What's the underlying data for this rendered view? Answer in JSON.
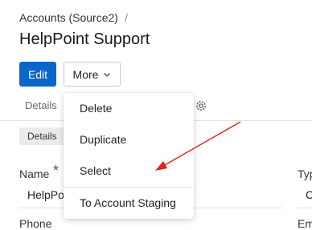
{
  "breadcrumb": {
    "parent": "Accounts (Source2)",
    "separator": "/"
  },
  "title": "HelpPoint Support",
  "toolbar": {
    "edit_label": "Edit",
    "more_label": "More"
  },
  "tabs": {
    "details": "Details",
    "settings_icon": "gear-icon"
  },
  "section": {
    "label": "Details"
  },
  "fields": {
    "name_label": "Name",
    "name_required": "*",
    "name_value": "HelpPoint Support",
    "type_label": "Typ",
    "type_value": "C",
    "phone_label": "Phone",
    "email_label": "Em"
  },
  "more_menu": {
    "items": [
      "Delete",
      "Duplicate",
      "Select",
      "To Account Staging"
    ]
  },
  "colors": {
    "primary": "#0a66c9",
    "annotation_arrow": "#e0221b"
  }
}
